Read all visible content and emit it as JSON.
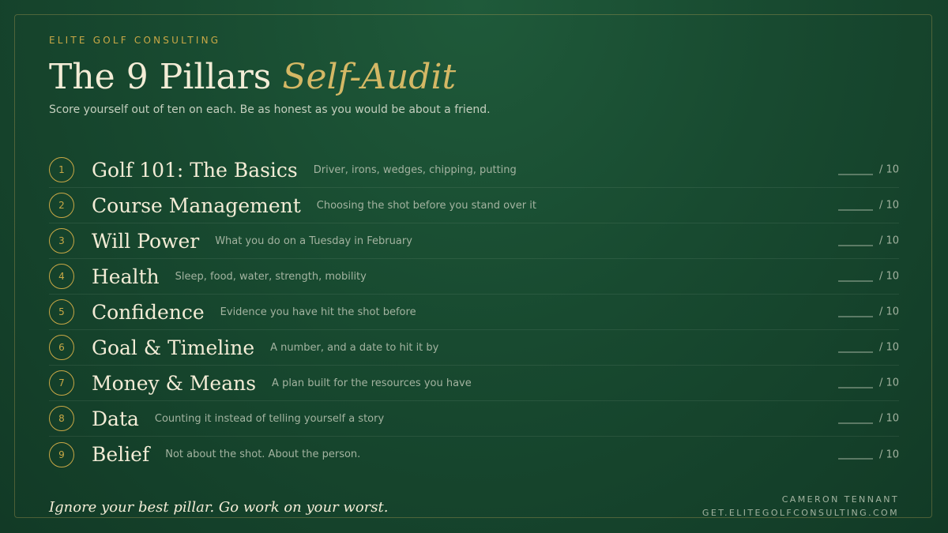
{
  "header": {
    "eyebrow": "ELITE GOLF CONSULTING",
    "title_main": "The 9 Pillars ",
    "title_accent": "Self-Audit",
    "subtitle": "Score yourself out of ten on each. Be as honest as you would be about a friend."
  },
  "score_suffix": "/ 10",
  "pillars": [
    {
      "num": "1",
      "name": "Golf 101: The Basics",
      "desc": "Driver, irons, wedges, chipping, putting"
    },
    {
      "num": "2",
      "name": "Course Management",
      "desc": "Choosing the shot before you stand over it"
    },
    {
      "num": "3",
      "name": "Will Power",
      "desc": "What you do on a Tuesday in February"
    },
    {
      "num": "4",
      "name": "Health",
      "desc": "Sleep, food, water, strength, mobility"
    },
    {
      "num": "5",
      "name": "Confidence",
      "desc": "Evidence you have hit the shot before"
    },
    {
      "num": "6",
      "name": "Goal & Timeline",
      "desc": "A number, and a date to hit it by"
    },
    {
      "num": "7",
      "name": "Money & Means",
      "desc": "A plan built for the resources you have"
    },
    {
      "num": "8",
      "name": "Data",
      "desc": "Counting it instead of telling yourself a story"
    },
    {
      "num": "9",
      "name": "Belief",
      "desc": "Not about the shot. About the person."
    }
  ],
  "footer": {
    "quote": "Ignore your best pillar. Go work on your worst.",
    "author": "CAMERON TENNANT",
    "url": "GET.ELITEGOLFCONSULTING.COM"
  },
  "colors": {
    "background": "#184a30",
    "gold": "#c9a846",
    "accent_text": "#d4b865",
    "cream": "#f3ecd6",
    "muted": "#a3b3a0"
  }
}
